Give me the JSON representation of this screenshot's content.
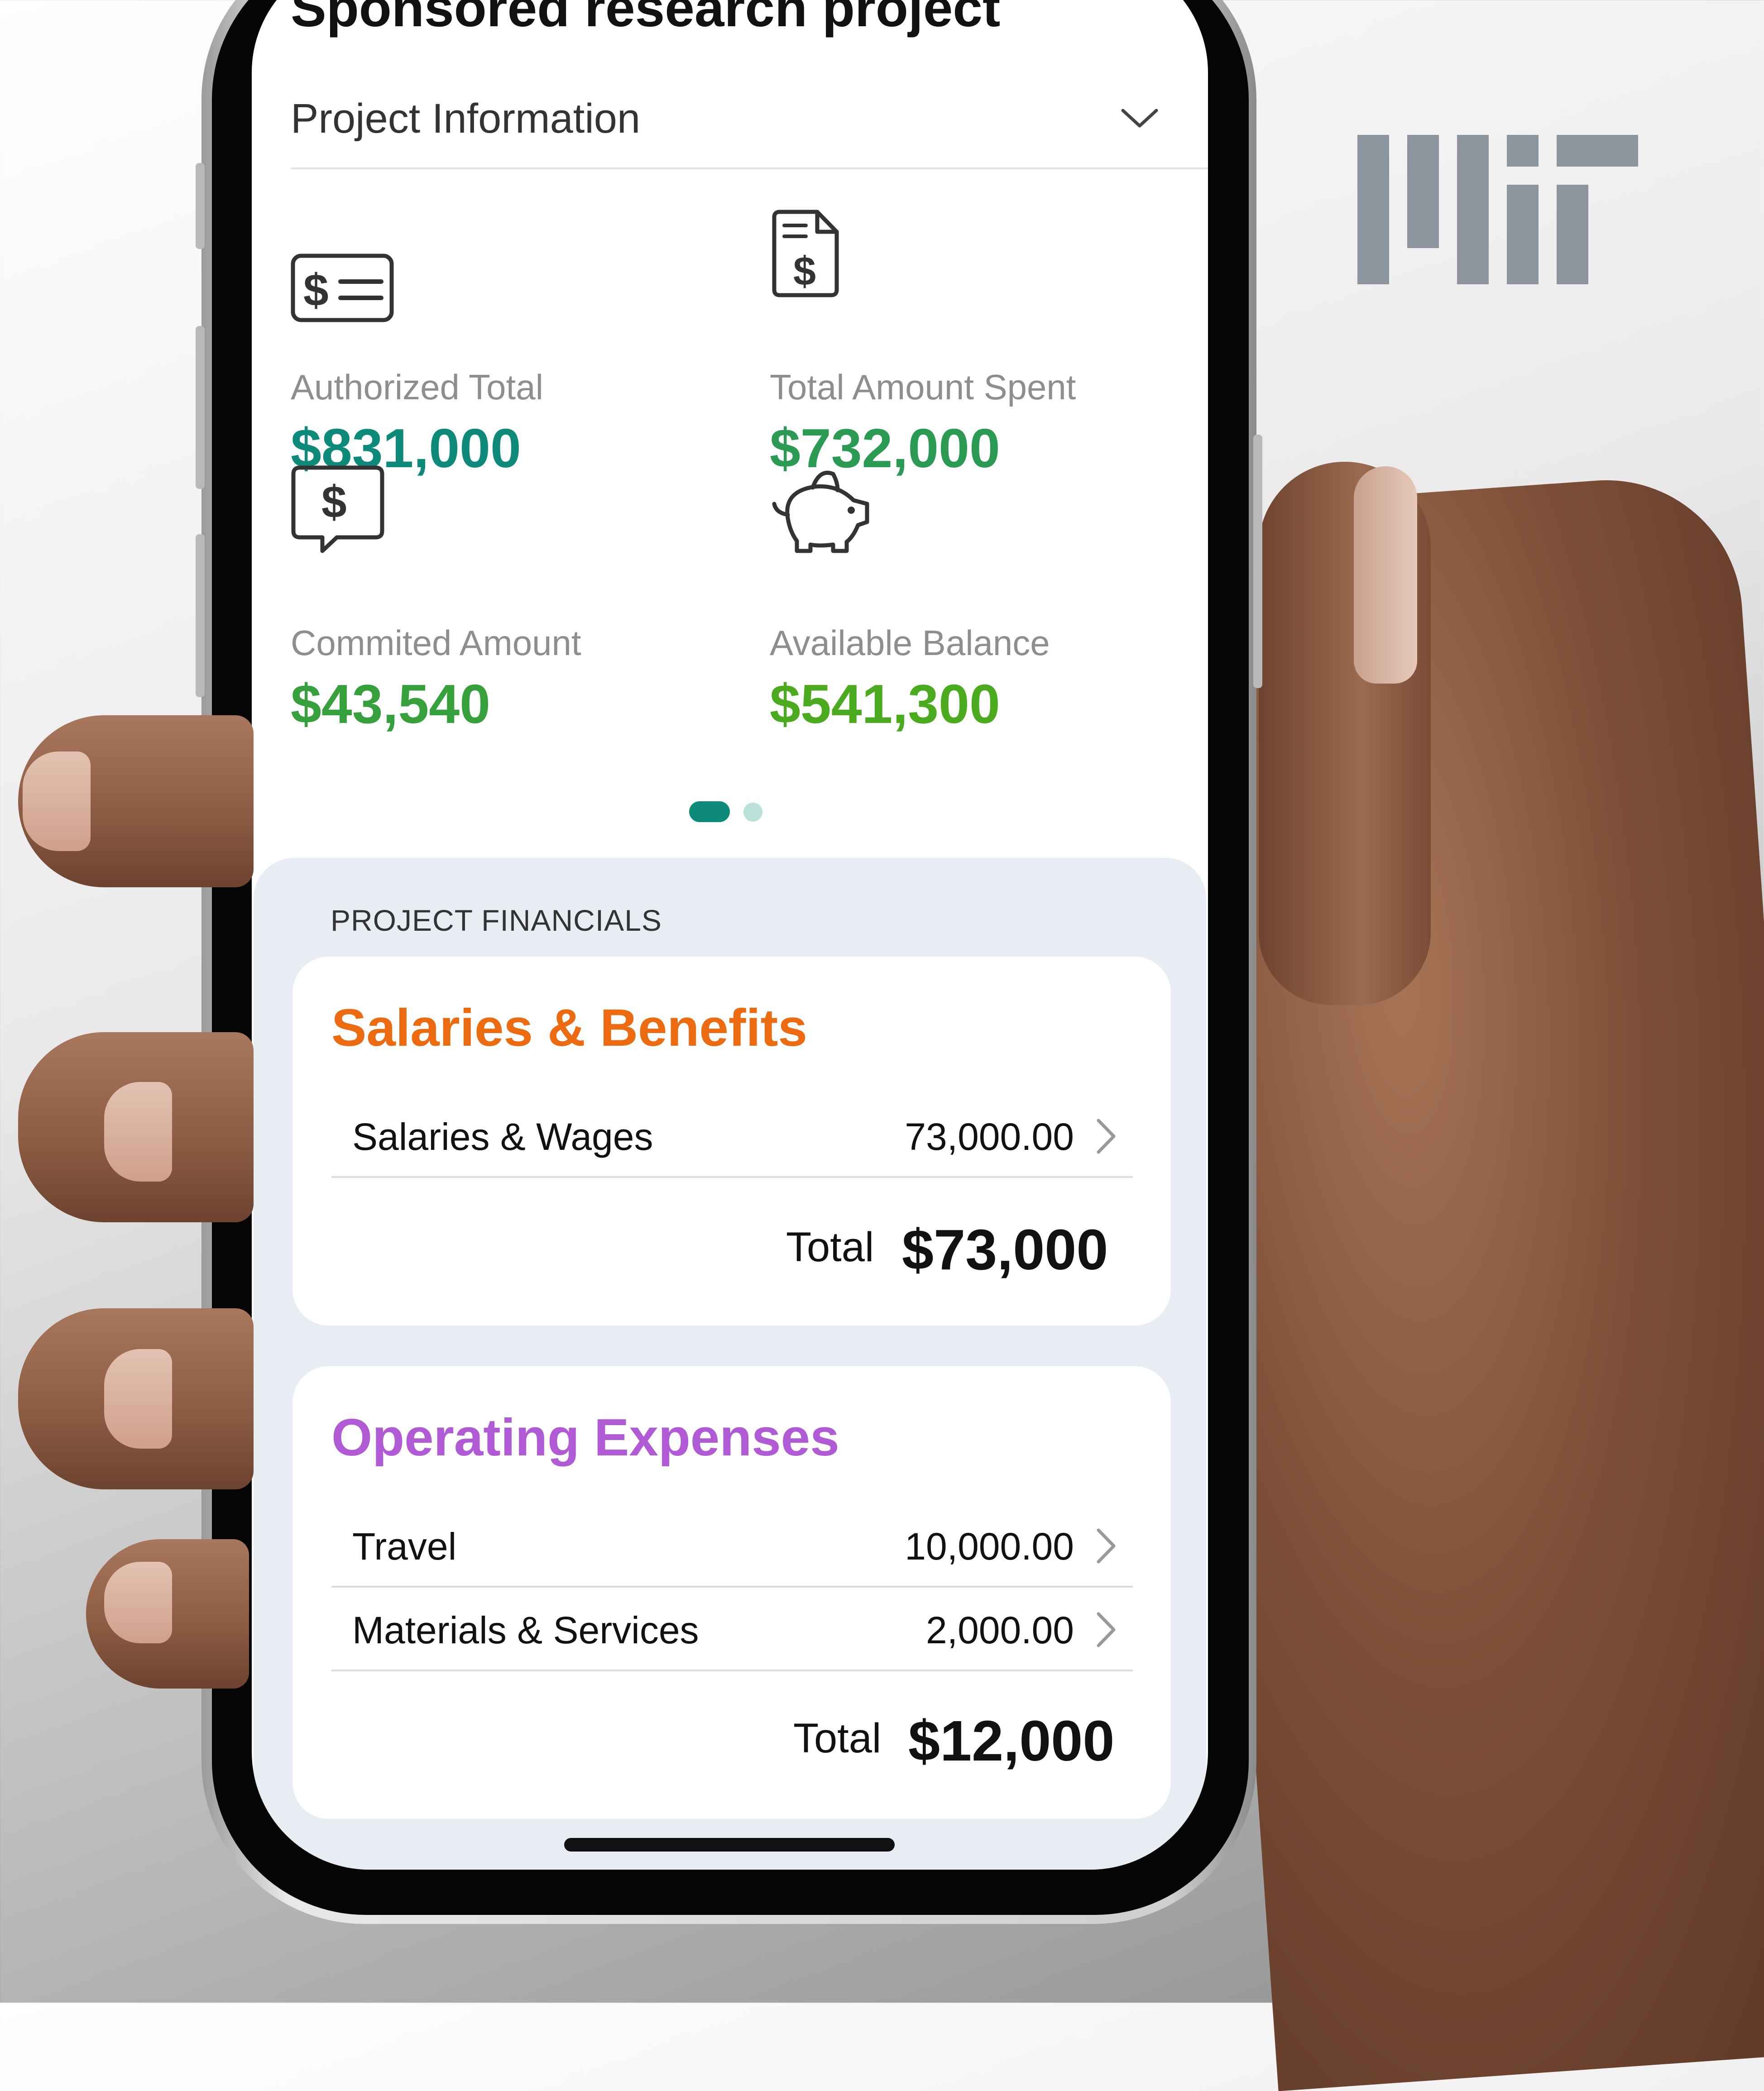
{
  "header": {
    "title": "Sponsored research project",
    "section_label": "Project Information"
  },
  "stats": [
    {
      "icon": "dollar-document-icon",
      "label": "Authorized Total",
      "value": "$831,000",
      "color": "#0e8a7a"
    },
    {
      "icon": "dollar-receipt-icon",
      "label": "Total Amount Spent",
      "value": "$732,000",
      "color": "#2b9a52"
    },
    {
      "icon": "dollar-speech-bubble-icon",
      "label": "Commited Amount",
      "value": "$43,540",
      "color": "#36a03c"
    },
    {
      "icon": "piggy-bank-icon",
      "label": "Available Balance",
      "value": "$541,300",
      "color": "#4aab1f"
    }
  ],
  "pager": {
    "active_page": 1,
    "page_count": 2
  },
  "financials": {
    "heading": "PROJECT FINANCIALS",
    "cards": [
      {
        "title": "Salaries & Benefits",
        "title_color": "#ec6a10",
        "items": [
          {
            "label": "Salaries  & Wages",
            "amount": "73,000.00"
          }
        ],
        "total_label": "Total",
        "total_value": "$73,000"
      },
      {
        "title": "Operating Expenses",
        "title_color": "#b05ad6",
        "items": [
          {
            "label": "Travel",
            "amount": "10,000.00"
          },
          {
            "label": "Materials & Services",
            "amount": "2,000.00"
          }
        ],
        "total_label": "Total",
        "total_value": "$12,000"
      }
    ]
  },
  "brand": {
    "logo": "mit-logo",
    "logo_color": "#8c959e"
  }
}
